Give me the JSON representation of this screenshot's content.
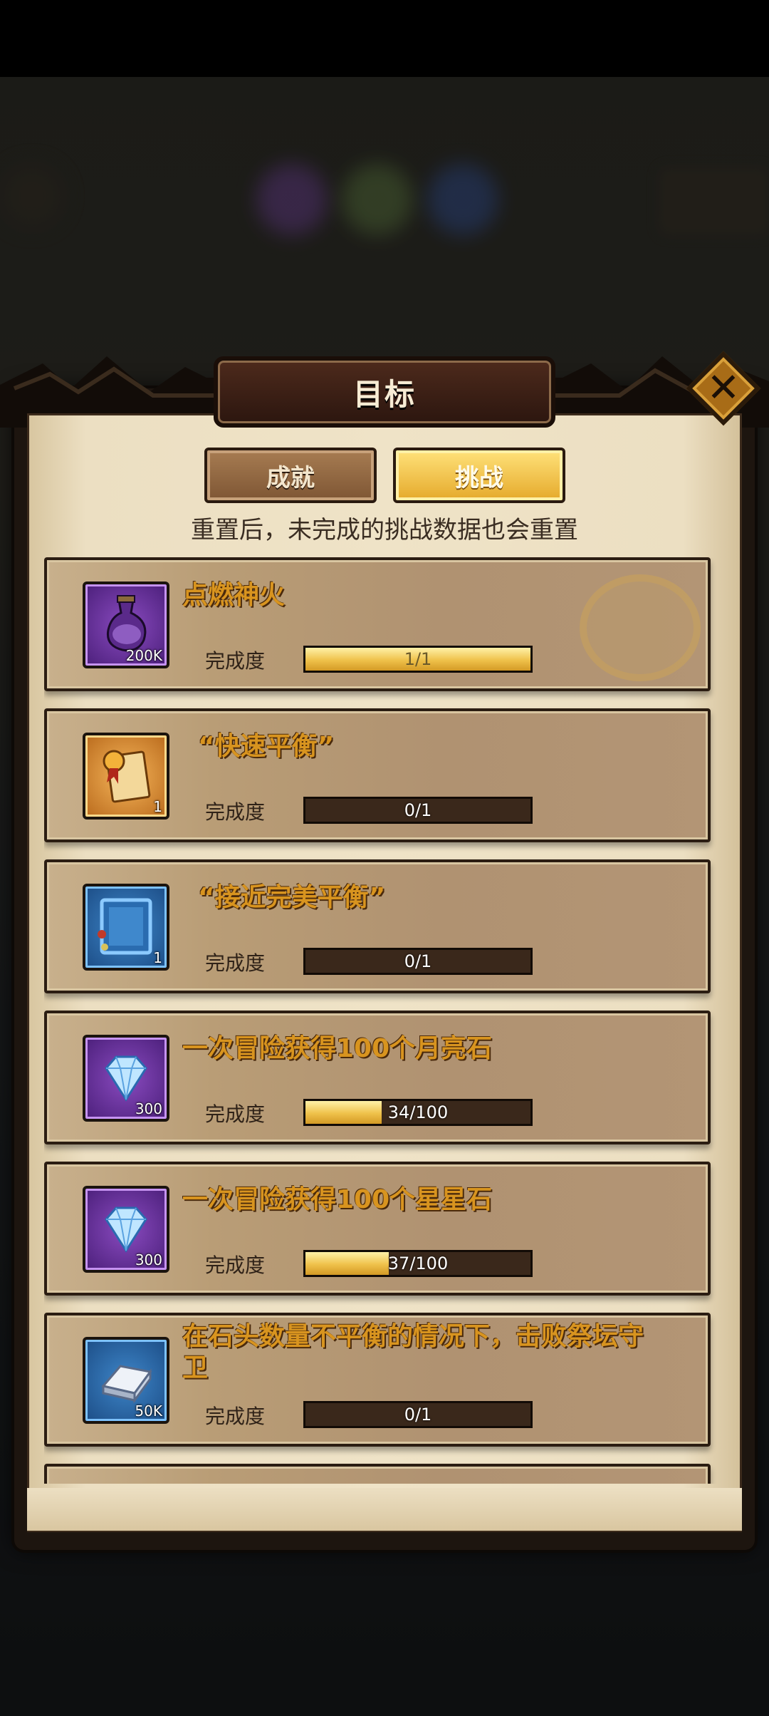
{
  "dialog": {
    "title": "目标",
    "close_icon": "close-x-icon"
  },
  "tabs": [
    {
      "label": "成就",
      "selected": false
    },
    {
      "label": "挑战",
      "selected": true
    }
  ],
  "notice": "重置后，未完成的挑战数据也会重置",
  "challenges": [
    {
      "title": "点燃神火",
      "icon": "potion-bottle-icon",
      "icon_color": "purple",
      "reward_count": "200K",
      "progress_label": "完成度",
      "progress_text": "1/1",
      "progress_fraction": 1.0
    },
    {
      "title": "“快速平衡”",
      "icon": "scroll-badge-icon",
      "icon_color": "orange",
      "reward_count": "1",
      "progress_label": "完成度",
      "progress_text": "0/1",
      "progress_fraction": 0.0
    },
    {
      "title": "“接近完美平衡”",
      "icon": "frame-icon",
      "icon_color": "blue",
      "reward_count": "1",
      "progress_label": "完成度",
      "progress_text": "0/1",
      "progress_fraction": 0.0
    },
    {
      "title": "一次冒险获得100个月亮石",
      "icon": "diamond-gem-icon",
      "icon_color": "purple",
      "reward_count": "300",
      "progress_label": "完成度",
      "progress_text": "34/100",
      "progress_fraction": 0.34
    },
    {
      "title": "一次冒险获得100个星星石",
      "icon": "diamond-gem-icon",
      "icon_color": "purple",
      "reward_count": "300",
      "progress_label": "完成度",
      "progress_text": "37/100",
      "progress_fraction": 0.37
    },
    {
      "title": "在石头数量不平衡的情况下，击败祭坛守卫",
      "icon": "silver-ingot-icon",
      "icon_color": "blue",
      "reward_count": "50K",
      "progress_label": "完成度",
      "progress_text": "0/1",
      "progress_fraction": 0.0
    }
  ]
}
